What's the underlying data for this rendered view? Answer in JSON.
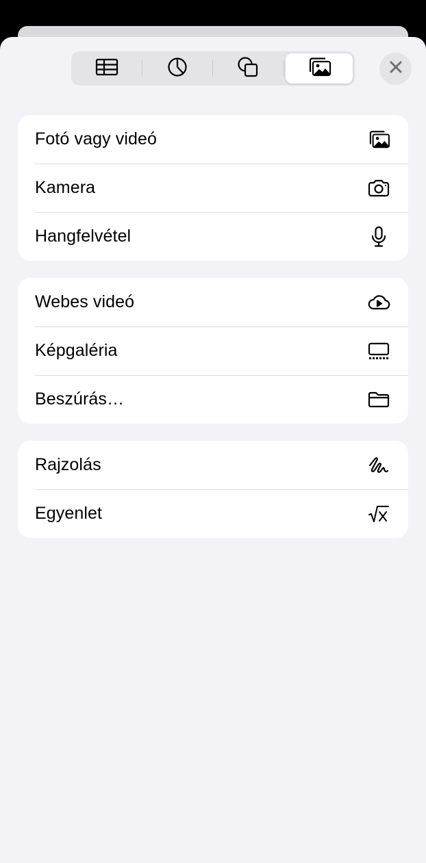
{
  "tabs": [
    {
      "name": "table",
      "icon": "table-icon",
      "selected": false
    },
    {
      "name": "chart",
      "icon": "chart-pie-icon",
      "selected": false
    },
    {
      "name": "shape",
      "icon": "shapes-icon",
      "selected": false
    },
    {
      "name": "media",
      "icon": "photo-stack-icon",
      "selected": true
    }
  ],
  "close_icon": "close-icon",
  "groups": [
    {
      "items": [
        {
          "label": "Fotó vagy videó",
          "icon": "photo-stack-icon"
        },
        {
          "label": "Kamera",
          "icon": "camera-icon"
        },
        {
          "label": "Hangfelvétel",
          "icon": "microphone-icon"
        }
      ]
    },
    {
      "items": [
        {
          "label": "Webes videó",
          "icon": "cloud-play-icon"
        },
        {
          "label": "Képgaléria",
          "icon": "gallery-icon"
        },
        {
          "label": "Beszúrás…",
          "icon": "folder-icon"
        }
      ]
    },
    {
      "items": [
        {
          "label": "Rajzolás",
          "icon": "scribble-icon"
        },
        {
          "label": "Egyenlet",
          "icon": "square-root-icon"
        }
      ]
    }
  ],
  "colors": {
    "sheet_background": "#f2f2f7",
    "segment_background": "#e3e3e8",
    "selected_segment": "#ffffff",
    "text": "#000000",
    "separator": "#dcdce0"
  }
}
